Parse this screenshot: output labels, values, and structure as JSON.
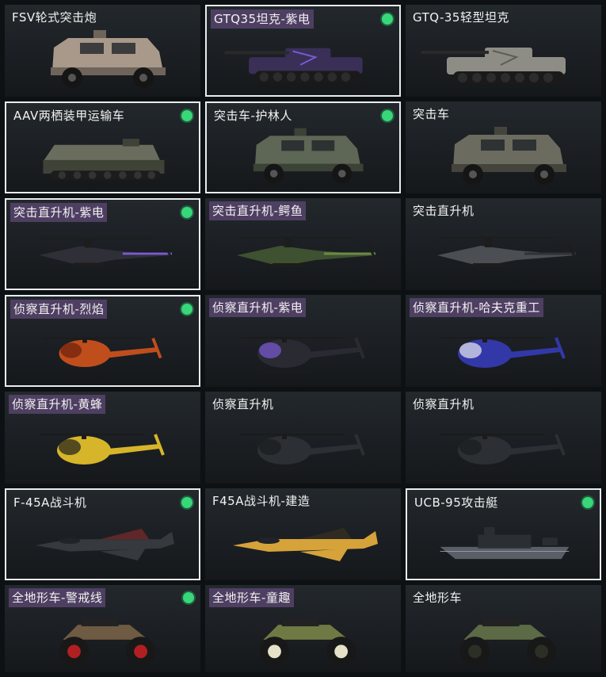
{
  "cards": [
    {
      "label": "FSV轮式突击炮",
      "kind": "armored",
      "color": "#a8998a",
      "accent": "#6e645a",
      "owned": false,
      "selected": false,
      "label_highlight": false
    },
    {
      "label": "GTQ35坦克-紫电",
      "kind": "tank",
      "color": "#3a2f57",
      "accent": "#7b5bd6",
      "owned": true,
      "selected": true,
      "label_highlight": true
    },
    {
      "label": "GTQ-35轻型坦克",
      "kind": "tank",
      "color": "#8e8d85",
      "accent": "#5d5c55",
      "owned": false,
      "selected": false,
      "label_highlight": false
    },
    {
      "label": "AAV两栖装甲运输车",
      "kind": "amphib",
      "color": "#6a6d5e",
      "accent": "#3f4236",
      "owned": true,
      "selected": true,
      "label_highlight": false
    },
    {
      "label": "突击车-护林人",
      "kind": "armored",
      "color": "#5e6655",
      "accent": "#3b4236",
      "owned": true,
      "selected": true,
      "label_highlight": false
    },
    {
      "label": "突击车",
      "kind": "armored",
      "color": "#6b6b60",
      "accent": "#44443c",
      "owned": false,
      "selected": false,
      "label_highlight": false
    },
    {
      "label": "突击直升机-紫电",
      "kind": "attack_heli",
      "color": "#2f2f37",
      "accent": "#7b5bd6",
      "owned": true,
      "selected": true,
      "label_highlight": true
    },
    {
      "label": "突击直升机-鳄鱼",
      "kind": "attack_heli",
      "color": "#3e5130",
      "accent": "#6c8a45",
      "owned": false,
      "selected": false,
      "label_highlight": true
    },
    {
      "label": "突击直升机",
      "kind": "attack_heli",
      "color": "#4b4e53",
      "accent": "#2f3236",
      "owned": false,
      "selected": false,
      "label_highlight": false
    },
    {
      "label": "侦察直升机-烈焰",
      "kind": "scout_heli",
      "color": "#c04e1c",
      "accent": "#6b1f0d",
      "owned": true,
      "selected": true,
      "label_highlight": true
    },
    {
      "label": "侦察直升机-紫电",
      "kind": "scout_heli",
      "color": "#2a2a33",
      "accent": "#7b5bd6",
      "owned": false,
      "selected": false,
      "label_highlight": true
    },
    {
      "label": "侦察直升机-哈夫克重工",
      "kind": "scout_heli",
      "color": "#3338a8",
      "accent": "#e9e9f2",
      "owned": false,
      "selected": false,
      "label_highlight": true
    },
    {
      "label": "侦察直升机-黄蜂",
      "kind": "scout_heli",
      "color": "#d7b52a",
      "accent": "#1c1c1c",
      "owned": false,
      "selected": false,
      "label_highlight": true
    },
    {
      "label": "侦察直升机",
      "kind": "scout_heli",
      "color": "#2c2f33",
      "accent": "#1a1c1f",
      "owned": false,
      "selected": false,
      "label_highlight": false
    },
    {
      "label": "侦察直升机",
      "kind": "scout_heli",
      "color": "#2c2f33",
      "accent": "#1a1c1f",
      "owned": false,
      "selected": false,
      "label_highlight": false
    },
    {
      "label": "F-45A战斗机",
      "kind": "jet",
      "color": "#36393d",
      "accent": "#8f2b2b",
      "owned": true,
      "selected": true,
      "label_highlight": false
    },
    {
      "label": "F45A战斗机-建造",
      "kind": "jet",
      "color": "#d6a23a",
      "accent": "#3c3322",
      "owned": false,
      "selected": false,
      "label_highlight": false
    },
    {
      "label": "UCB-95攻击艇",
      "kind": "boat",
      "color": "#5a5e66",
      "accent": "#2b2e33",
      "owned": true,
      "selected": true,
      "label_highlight": false
    },
    {
      "label": "全地形车-警戒线",
      "kind": "atv",
      "color": "#6f5a43",
      "accent": "#b21f22",
      "owned": true,
      "selected": false,
      "label_highlight": true
    },
    {
      "label": "全地形车-童趣",
      "kind": "atv",
      "color": "#6e7a43",
      "accent": "#e5e2c8",
      "owned": false,
      "selected": false,
      "label_highlight": true
    },
    {
      "label": "全地形车",
      "kind": "atv",
      "color": "#5c6a45",
      "accent": "#2c2f25",
      "owned": false,
      "selected": false,
      "label_highlight": false
    }
  ]
}
